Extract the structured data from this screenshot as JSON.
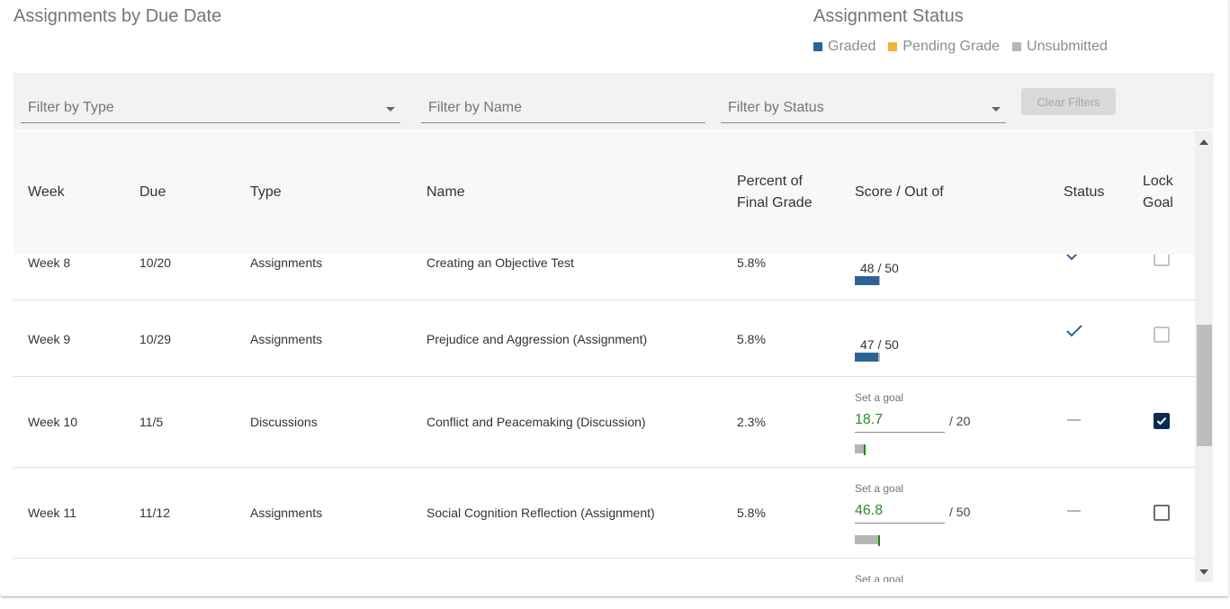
{
  "header": {
    "title": "Assignments by Due Date",
    "legend_title": "Assignment Status",
    "legend": [
      {
        "label": "Graded",
        "color": "#2d6394"
      },
      {
        "label": "Pending Grade",
        "color": "#f5b041"
      },
      {
        "label": "Unsubmitted",
        "color": "#b5b5b5"
      }
    ]
  },
  "filters": {
    "type_placeholder": "Filter by Type",
    "name_placeholder": "Filter by Name",
    "status_placeholder": "Filter by Status",
    "clear_label": "Clear Filters"
  },
  "table": {
    "columns": {
      "week": "Week",
      "due": "Due",
      "type": "Type",
      "name": "Name",
      "percent_line1": "Percent of",
      "percent_line2": "Final Grade",
      "score": "Score / Out of",
      "status": "Status",
      "lock_line1": "Lock",
      "lock_line2": "Goal"
    },
    "rows": [
      {
        "week": "Week 8",
        "due": "10/20",
        "type": "Assignments",
        "name": "Creating an Objective Test",
        "percent": "5.8%",
        "score": "48",
        "out_of": "/ 50",
        "score_fraction": 0.96,
        "status": "graded",
        "locked": false
      },
      {
        "week": "Week 9",
        "due": "10/29",
        "type": "Assignments",
        "name": "Prejudice and Aggression (Assignment)",
        "percent": "5.8%",
        "score": "47",
        "out_of": "/ 50",
        "score_fraction": 0.94,
        "status": "graded",
        "locked": false
      },
      {
        "week": "Week 10",
        "due": "11/5",
        "type": "Discussions",
        "name": "Conflict and Peacemaking (Discussion)",
        "percent": "2.3%",
        "goal_label": "Set a goal",
        "goal": "18.7",
        "out_of": "/ 20",
        "goal_fraction": 0.935,
        "status": "unsubmitted",
        "locked": true
      },
      {
        "week": "Week 11",
        "due": "11/12",
        "type": "Assignments",
        "name": "Social Cognition Reflection (Assignment)",
        "percent": "5.8%",
        "goal_label": "Set a goal",
        "goal": "46.8",
        "out_of": "/ 50",
        "goal_fraction": 0.936,
        "status": "unsubmitted",
        "locked": false
      },
      {
        "goal_label": "Set a goal"
      }
    ]
  }
}
